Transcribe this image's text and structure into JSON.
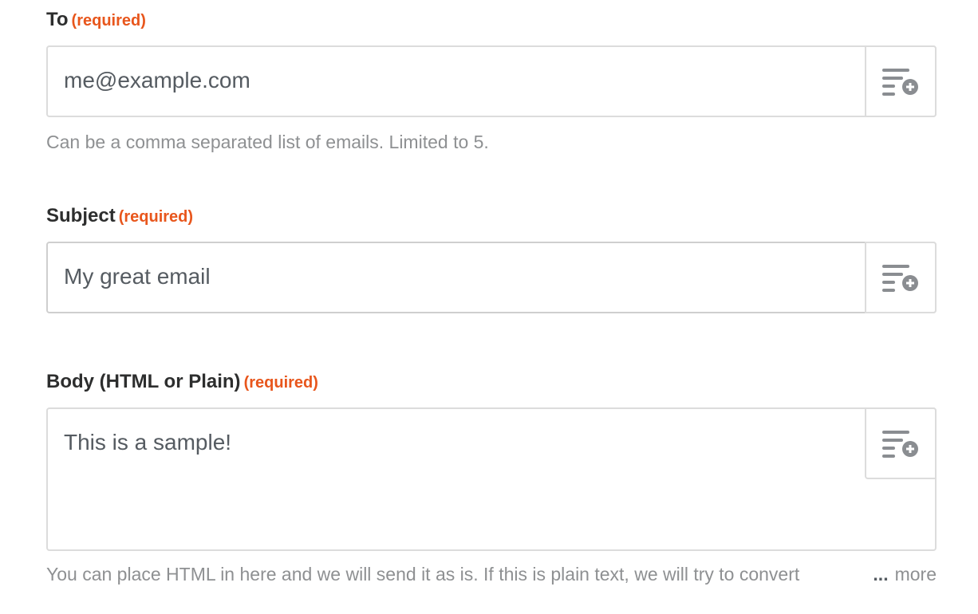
{
  "fields": {
    "to": {
      "label": "To",
      "required": "(required)",
      "value": "me@example.com",
      "help": "Can be a comma separated list of emails. Limited to 5."
    },
    "subject": {
      "label": "Subject",
      "required": "(required)",
      "value": "My great email"
    },
    "body": {
      "label": "Body (HTML or Plain)",
      "required": "(required)",
      "value": "This is a sample!",
      "help": "You can place HTML in here and we will send it as is. If this is plain text, we will try to convert",
      "ellipsis": "...",
      "more_label": "more"
    }
  },
  "icons": {
    "insert_data": "list-plus-icon"
  },
  "colors": {
    "required": "#e8561c",
    "label": "#2d2e2e",
    "help": "#8e9092",
    "border": "#dcdcdc",
    "icon": "#8a8d91"
  }
}
